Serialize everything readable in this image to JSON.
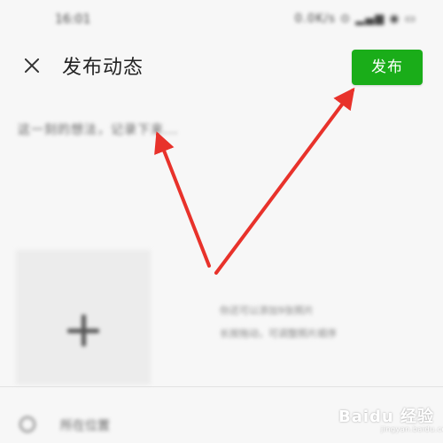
{
  "status_bar": {
    "time": "16:01",
    "icons_text": "0.0K/s ⊙ ▂▄▆ ◉ ▭"
  },
  "header": {
    "title": "发布动态",
    "publish_label": "发布",
    "close_icon": "close-icon"
  },
  "compose": {
    "placeholder": "这一刻的想法，记录下来..."
  },
  "photos": {
    "add_icon": "plus-icon",
    "hint_line1": "你还可以添加9张照片",
    "hint_line2": "长按拖动，可调整照片顺序"
  },
  "location": {
    "label": "所在位置"
  },
  "watermark": {
    "brand": "Baidu 经验",
    "url": "jingyan.baidu.com"
  },
  "colors": {
    "accent": "#1aad19",
    "arrow": "#e8322b",
    "background": "#f7f7f7"
  }
}
